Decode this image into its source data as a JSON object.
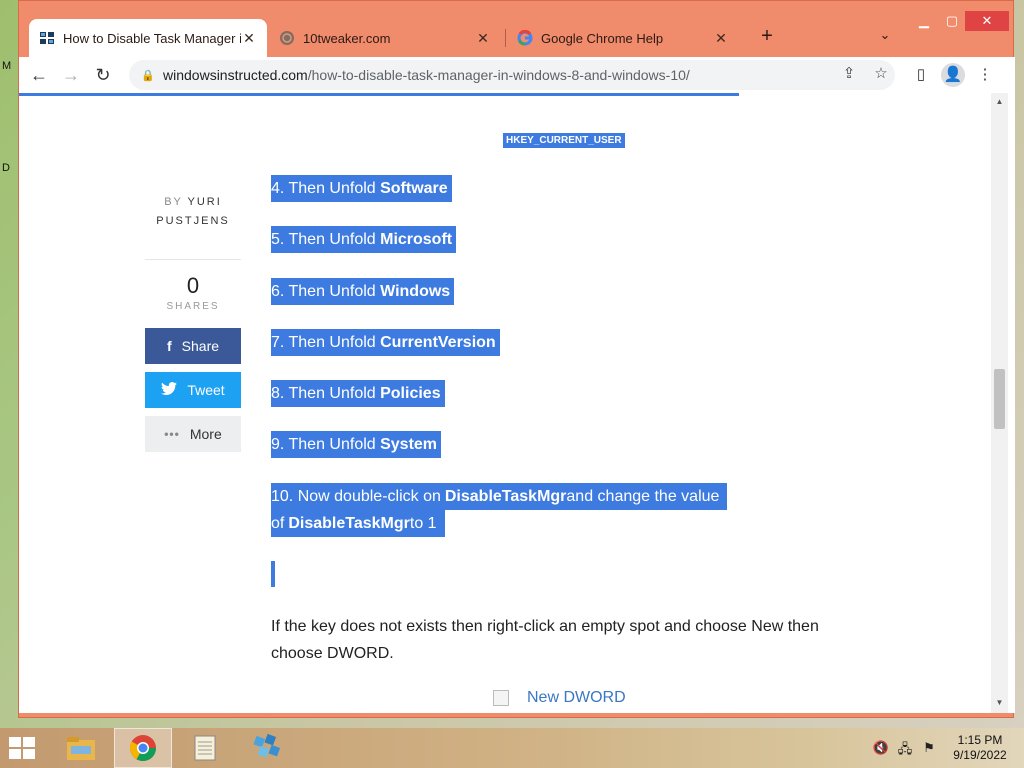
{
  "desktop": {
    "edge_chars": [
      "M",
      "D"
    ]
  },
  "tabs": [
    {
      "title": "How to Disable Task Manager in",
      "active": true
    },
    {
      "title": "10tweaker.com",
      "active": false
    },
    {
      "title": "Google Chrome Help",
      "active": false
    }
  ],
  "toolbar": {
    "url_host": "windowsinstructed.com",
    "url_path": "/how-to-disable-task-manager-in-windows-8-and-windows-10/"
  },
  "page": {
    "registry_key": "HKEY_CURRENT_USER",
    "author_by": "BY",
    "author_name": "YURI PUSTJENS",
    "share_count": "0",
    "share_label": "SHARES",
    "share_fb": "Share",
    "share_tw": "Tweet",
    "share_more": "More",
    "steps": [
      {
        "prefix": "4. Then Unfold ",
        "bold": "Software"
      },
      {
        "prefix": "5. Then Unfold ",
        "bold": "Microsoft"
      },
      {
        "prefix": "6. Then Unfold ",
        "bold": "Windows"
      },
      {
        "prefix": "7. Then Unfold ",
        "bold": "CurrentVersion"
      },
      {
        "prefix": "8. Then Unfold ",
        "bold": "Policies"
      },
      {
        "prefix": "9. Then Unfold ",
        "bold": "System"
      }
    ],
    "step10": {
      "line1_a": "10. Now double-click on ",
      "line1_b": "DisableTaskMgr",
      "line1_c": " and change the value",
      "line2_a": "of ",
      "line2_b": "DisableTaskMgr",
      "line2_c": " to 1"
    },
    "paragraph": "If the key does not exists then right-click an empty spot and choose New then choose DWORD.",
    "image_alt": "New DWORD"
  },
  "taskbar": {
    "time": "1:15 PM",
    "date": "9/19/2022"
  },
  "colors": {
    "tabstrip": "#f08b6c",
    "selection": "#3d7be0",
    "facebook": "#3b5998",
    "twitter": "#1da1f2"
  }
}
